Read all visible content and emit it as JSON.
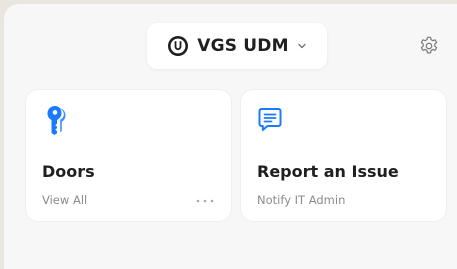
{
  "header": {
    "console_name": "VGS UDM",
    "logo_icon": "unifi-logo-icon",
    "dropdown_icon": "chevron-down-icon",
    "settings_icon": "gear-icon"
  },
  "cards": [
    {
      "title": "Doors",
      "subtitle": "View All",
      "icon": "key-icon",
      "more_icon": "more-dots-icon"
    },
    {
      "title": "Report an Issue",
      "subtitle": "Notify IT Admin",
      "icon": "chat-message-icon"
    }
  ],
  "colors": {
    "accent": "#1a7bff",
    "card_background": "#ffffff",
    "panel_background": "#f7f7f7",
    "text_primary": "#1f1f1f",
    "text_secondary": "#8b8b8b"
  }
}
